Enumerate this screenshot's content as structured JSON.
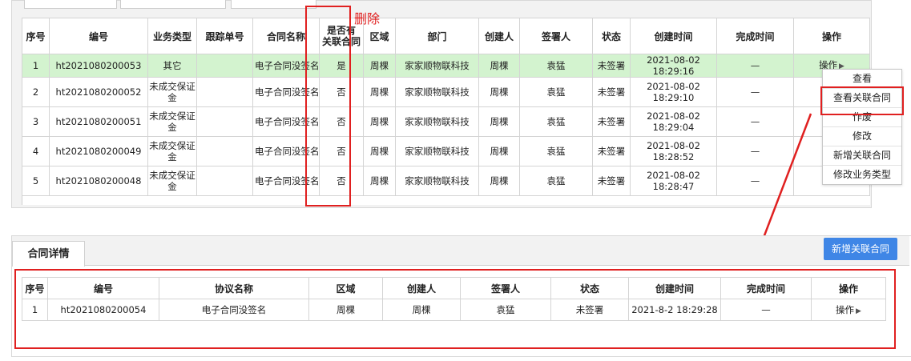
{
  "annotation": {
    "delete_label": "删除"
  },
  "top_table": {
    "headers": {
      "seq": "序号",
      "code": "编号",
      "biz_type": "业务类型",
      "track_no": "跟踪单号",
      "contract_name": "合同名称",
      "has_related_1": "是否有",
      "has_related_2": "关联合同",
      "region": "区域",
      "dept": "部门",
      "creator": "创建人",
      "signer": "签署人",
      "status": "状态",
      "created": "创建时间",
      "finished": "完成时间",
      "ops": "操作"
    },
    "rows": [
      {
        "seq": "1",
        "code": "ht2021080200053",
        "biz1": "其它",
        "biz2": "",
        "track": "",
        "contract": "电子合同没签名",
        "related": "是",
        "region": "周棵",
        "dept": "家家顺物联科技",
        "creator": "周棵",
        "signer": "袁猛",
        "status": "未签署",
        "created": "2021-08-02 18:29:16",
        "finished": "—",
        "op": "操作"
      },
      {
        "seq": "2",
        "code": "ht2021080200052",
        "biz1": "未成交保证",
        "biz2": "金",
        "track": "",
        "contract": "电子合同没签名",
        "related": "否",
        "region": "周棵",
        "dept": "家家顺物联科技",
        "creator": "周棵",
        "signer": "袁猛",
        "status": "未签署",
        "created": "2021-08-02 18:29:10",
        "finished": "—",
        "op": ""
      },
      {
        "seq": "3",
        "code": "ht2021080200051",
        "biz1": "未成交保证",
        "biz2": "金",
        "track": "",
        "contract": "电子合同没签名",
        "related": "否",
        "region": "周棵",
        "dept": "家家顺物联科技",
        "creator": "周棵",
        "signer": "袁猛",
        "status": "未签署",
        "created": "2021-08-02 18:29:04",
        "finished": "—",
        "op": ""
      },
      {
        "seq": "4",
        "code": "ht2021080200049",
        "biz1": "未成交保证",
        "biz2": "金",
        "track": "",
        "contract": "电子合同没签名",
        "related": "否",
        "region": "周棵",
        "dept": "家家顺物联科技",
        "creator": "周棵",
        "signer": "袁猛",
        "status": "未签署",
        "created": "2021-08-02 18:28:52",
        "finished": "—",
        "op": ""
      },
      {
        "seq": "5",
        "code": "ht2021080200048",
        "biz1": "未成交保证",
        "biz2": "金",
        "track": "",
        "contract": "电子合同没签名",
        "related": "否",
        "region": "周棵",
        "dept": "家家顺物联科技",
        "creator": "周棵",
        "signer": "袁猛",
        "status": "未签署",
        "created": "2021-08-02 18:28:47",
        "finished": "—",
        "op": ""
      }
    ]
  },
  "op_menu": {
    "items": [
      "查看",
      "查看关联合同",
      "作废",
      "修改",
      "新增关联合同",
      "修改业务类型"
    ]
  },
  "detail_panel": {
    "tab_label": "合同详情",
    "add_button": "新增关联合同",
    "headers": {
      "seq": "序号",
      "code": "编号",
      "name": "协议名称",
      "region": "区域",
      "creator": "创建人",
      "signer": "签署人",
      "status": "状态",
      "created": "创建时间",
      "finished": "完成时间",
      "ops": "操作"
    },
    "rows": [
      {
        "seq": "1",
        "code": "ht2021080200054",
        "name": "电子合同没签名",
        "region": "周棵",
        "creator": "周棵",
        "signer": "袁猛",
        "status": "未签署",
        "created": "2021-8-2 18:29:28",
        "finished": "—",
        "op": "操作"
      }
    ]
  },
  "colors": {
    "highlight_row": "#d3f3cf",
    "annotation_red": "#e02020",
    "primary_button": "#3f86e6"
  }
}
